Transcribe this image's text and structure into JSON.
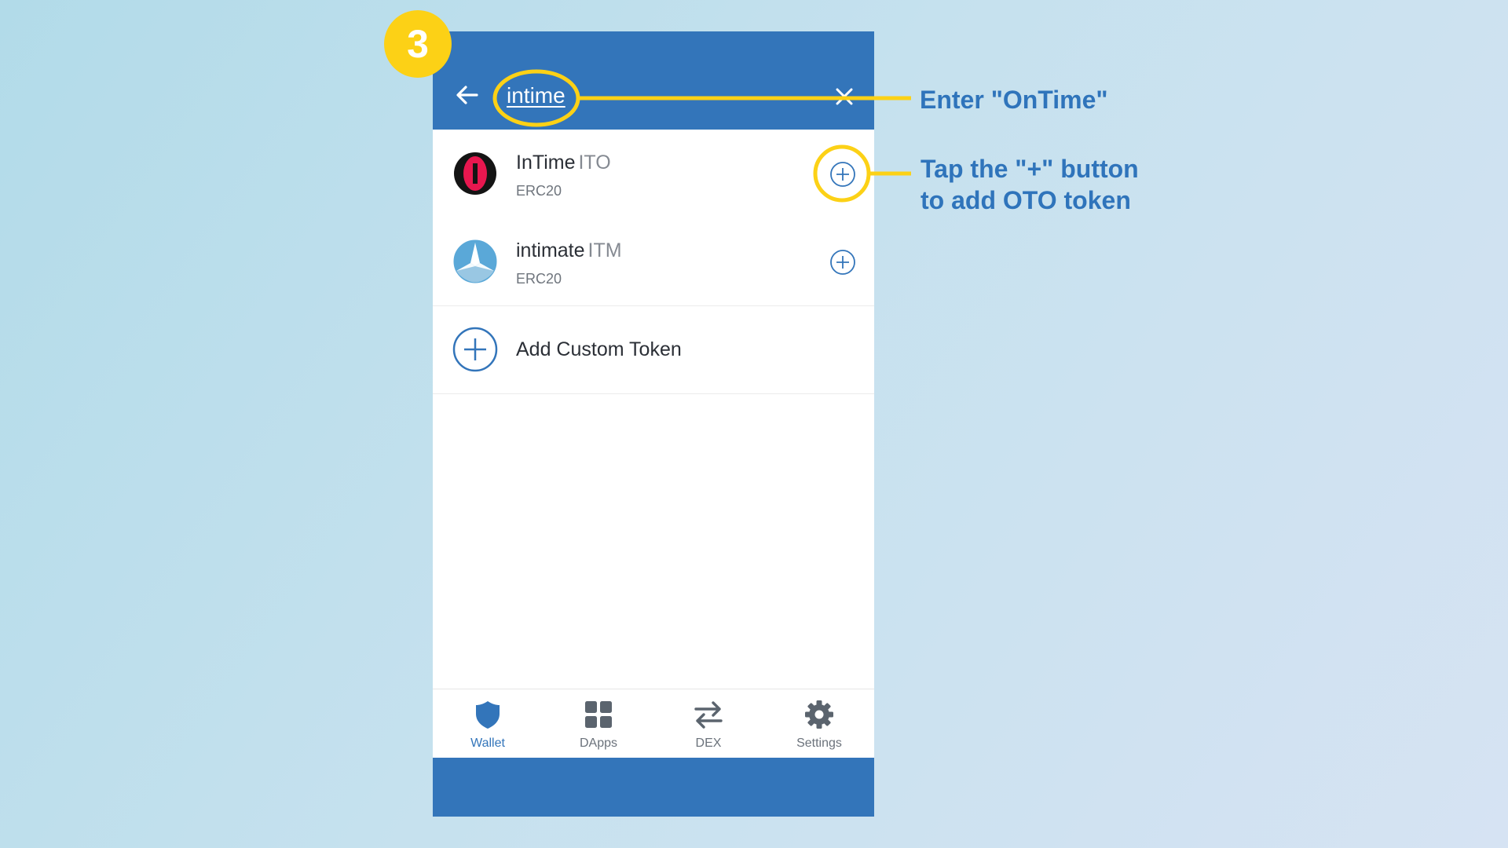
{
  "step_number": "3",
  "search": {
    "query": "intime"
  },
  "tokens": [
    {
      "name": "InTime",
      "symbol": "ITO",
      "standard": "ERC20"
    },
    {
      "name": "intimate",
      "symbol": "ITM",
      "standard": "ERC20"
    }
  ],
  "add_custom_label": "Add Custom Token",
  "nav": [
    {
      "label": "Wallet",
      "icon": "shield-icon",
      "active": true
    },
    {
      "label": "DApps",
      "icon": "grid-icon",
      "active": false
    },
    {
      "label": "DEX",
      "icon": "swap-arrows-icon",
      "active": false
    },
    {
      "label": "Settings",
      "icon": "gear-icon",
      "active": false
    }
  ],
  "annotations": {
    "search_hint": "Enter \"OnTime\"",
    "add_hint_line1": "Tap the \"+\" button",
    "add_hint_line2": "to add OTO token"
  },
  "colors": {
    "brand_blue": "#3375ba",
    "highlight_yellow": "#fcd116",
    "annotation_text": "#2f74bb",
    "page_bg_start": "#b2dbe9",
    "page_bg_end": "#d6e3f3"
  }
}
